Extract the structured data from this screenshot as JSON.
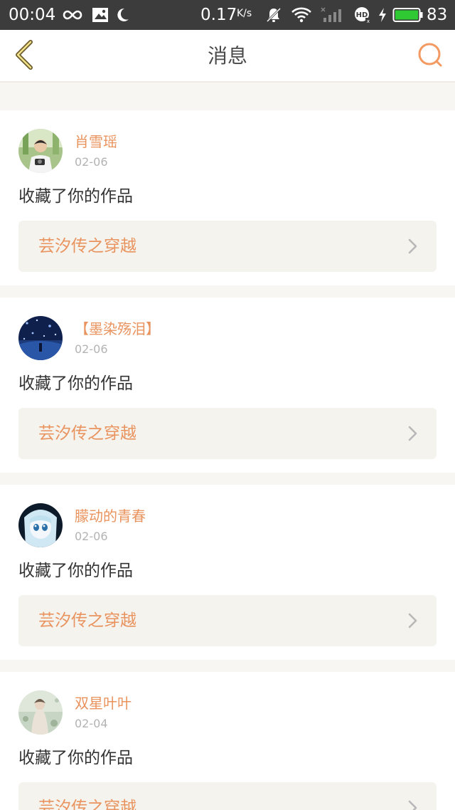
{
  "status_bar": {
    "time": "00:04",
    "speed": "0.17",
    "speed_unit": "K/s",
    "battery": "83",
    "icons": [
      "infinity-icon",
      "image-icon",
      "moon-icon",
      "mute-bell-icon",
      "wifi-icon",
      "signal-icon",
      "hd-icon",
      "charging-icon",
      "battery-icon"
    ]
  },
  "header": {
    "title": "消息",
    "back_icon": "chevron-left-icon",
    "search_icon": "search-icon",
    "accent": "#e9935e"
  },
  "colors": {
    "name": "#e9935e",
    "background": "#f7f6f3",
    "link_bg": "#f4f3ee"
  },
  "messages": [
    {
      "user": "肖雪瑶",
      "date": "02-06",
      "action": "收藏了你的作品",
      "work": "芸汐传之穿越"
    },
    {
      "user": "【墨染殇泪】",
      "date": "02-06",
      "action": "收藏了你的作品",
      "work": "芸汐传之穿越"
    },
    {
      "user": "朦动的青春",
      "date": "02-06",
      "action": "收藏了你的作品",
      "work": "芸汐传之穿越"
    },
    {
      "user": "双星叶叶",
      "date": "02-04",
      "action": "收藏了你的作品",
      "work": "芸汐传之穿越"
    }
  ]
}
